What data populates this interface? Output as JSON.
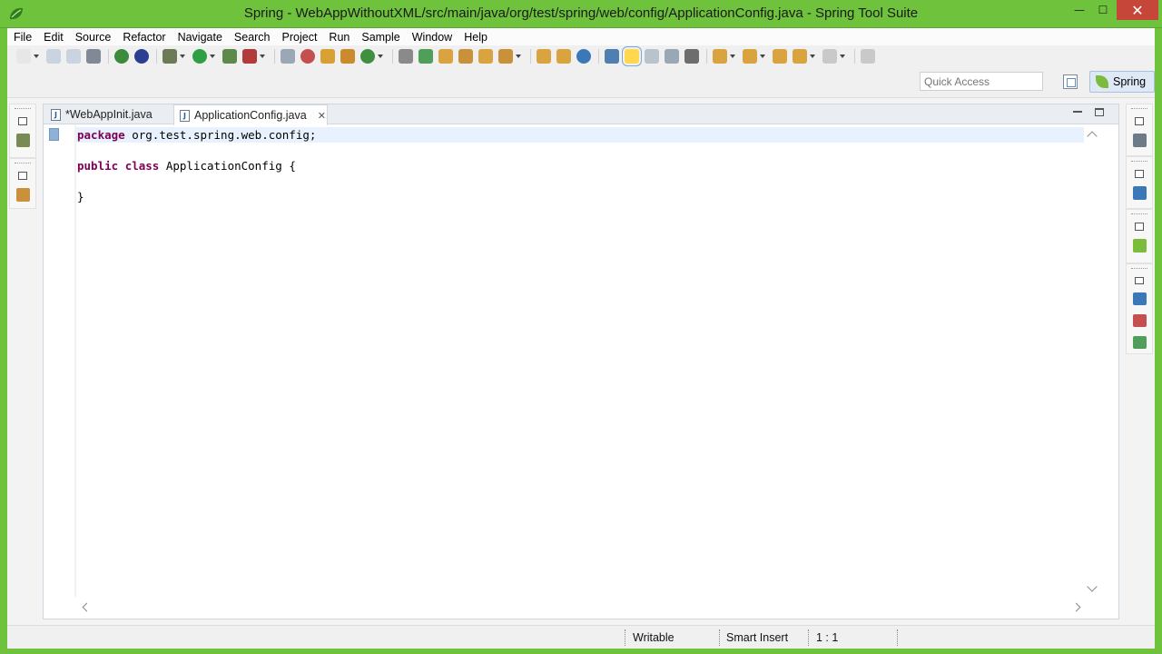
{
  "window": {
    "title": "Spring - WebAppWithoutXML/src/main/java/org/test/spring/web/config/ApplicationConfig.java - Spring Tool Suite",
    "minimize_glyph": "—",
    "maximize_glyph": "☐",
    "close_glyph": "✕",
    "frame_color": "#6fc23c"
  },
  "menu": [
    {
      "label": "File"
    },
    {
      "label": "Edit"
    },
    {
      "label": "Source"
    },
    {
      "label": "Refactor"
    },
    {
      "label": "Navigate"
    },
    {
      "label": "Search"
    },
    {
      "label": "Project"
    },
    {
      "label": "Run"
    },
    {
      "label": "Sample"
    },
    {
      "label": "Window"
    },
    {
      "label": "Help"
    }
  ],
  "toolbar_icons": [
    {
      "name": "new-icon",
      "color": "#e7e7e7",
      "caret": true
    },
    {
      "name": "save-icon",
      "color": "#c9d4e0"
    },
    {
      "name": "save-all-icon",
      "color": "#c9d4e0"
    },
    {
      "name": "print-icon",
      "color": "#7f8a96"
    },
    {
      "name": "sep"
    },
    {
      "name": "spring-globe-icon",
      "color": "#3c8b3c",
      "round": true
    },
    {
      "name": "spring-server-icon",
      "color": "#2a3f8f",
      "round": true
    },
    {
      "name": "sep"
    },
    {
      "name": "debug-icon",
      "color": "#6b7b55",
      "caret": true
    },
    {
      "name": "run-icon",
      "color": "#2f9e44",
      "round": true,
      "caret": true
    },
    {
      "name": "coverage-icon",
      "color": "#5d8a4a"
    },
    {
      "name": "external-tools-icon",
      "color": "#b23a3a",
      "caret": true
    },
    {
      "name": "sep"
    },
    {
      "name": "toggle-breakpoint-icon",
      "color": "#9aa7b5"
    },
    {
      "name": "skip-breakpoints-icon",
      "color": "#c44f4f",
      "round": true
    },
    {
      "name": "new-java-project-icon",
      "color": "#d9a033"
    },
    {
      "name": "new-package-icon",
      "color": "#c98b2c"
    },
    {
      "name": "new-class-icon",
      "color": "#3f8f3f",
      "round": true,
      "caret": true
    },
    {
      "name": "sep"
    },
    {
      "name": "search-refs-icon",
      "color": "#8a8a8a"
    },
    {
      "name": "open-resource-icon",
      "color": "#4f9e5a"
    },
    {
      "name": "open-type-icon",
      "color": "#d9a440"
    },
    {
      "name": "hierarchy-icon",
      "color": "#c9923a"
    },
    {
      "name": "folder-open-icon",
      "color": "#d9a440"
    },
    {
      "name": "magic-wand-icon",
      "color": "#c9923a",
      "caret": true
    },
    {
      "name": "sep"
    },
    {
      "name": "open-task-icon",
      "color": "#d9a440"
    },
    {
      "name": "open-folder-icon",
      "color": "#d9a440"
    },
    {
      "name": "web-browser-icon",
      "color": "#3a78b8",
      "round": true
    },
    {
      "name": "sep"
    },
    {
      "name": "search-icon",
      "color": "#4f7fb0"
    },
    {
      "name": "highlight-icon",
      "color": "#ffd84d",
      "active": true
    },
    {
      "name": "mark-occurrences-icon",
      "color": "#b9c3cc"
    },
    {
      "name": "block-selection-icon",
      "color": "#9aa7b5"
    },
    {
      "name": "show-whitespace-icon",
      "color": "#6d6d6d"
    },
    {
      "name": "sep"
    },
    {
      "name": "next-annotation-icon",
      "color": "#d9a440",
      "caret": true
    },
    {
      "name": "prev-annotation-icon",
      "color": "#d9a440",
      "caret": true
    },
    {
      "name": "last-edit-icon",
      "color": "#d9a440"
    },
    {
      "name": "back-icon",
      "color": "#d9a440",
      "caret": true
    },
    {
      "name": "forward-icon",
      "color": "#c9c9c9",
      "caret": true
    },
    {
      "name": "sep"
    },
    {
      "name": "pin-editor-icon",
      "color": "#c9c9c9"
    }
  ],
  "quick_access": {
    "placeholder": "Quick Access"
  },
  "perspective": {
    "label": "Spring"
  },
  "tabs": [
    {
      "label": "*WebAppInit.java",
      "active": false
    },
    {
      "label": "ApplicationConfig.java",
      "active": true
    }
  ],
  "editor": {
    "lines": [
      {
        "parts": [
          {
            "t": "package",
            "kw": true
          },
          {
            "t": " org.test.spring.web.config;",
            "kw": false
          }
        ],
        "current": true
      },
      {
        "parts": [],
        "current": false
      },
      {
        "parts": [
          {
            "t": "public",
            "kw": true
          },
          {
            "t": " ",
            "kw": false
          },
          {
            "t": "class",
            "kw": true
          },
          {
            "t": " ApplicationConfig {",
            "kw": false
          }
        ],
        "current": false
      },
      {
        "parts": [],
        "current": false
      },
      {
        "parts": [
          {
            "t": "}",
            "kw": false
          }
        ],
        "current": false
      }
    ]
  },
  "status": {
    "writable": "Writable",
    "insert_mode": "Smart Insert",
    "position": "1 : 1"
  },
  "left_trim_icons": [
    {
      "name": "package-explorer-icon",
      "color": "#7a8a55"
    },
    {
      "name": "hierarchy-view-icon",
      "color": "#c9923a"
    }
  ],
  "right_trim_icons": [
    {
      "name": "task-list-icon",
      "color": "#6d7a88"
    },
    {
      "name": "outline-icon",
      "color": "#3a78b8"
    },
    {
      "name": "spring-explorer-icon",
      "color": "#7cbc3c"
    },
    {
      "name": "console-icon",
      "color": "#3a78b8"
    },
    {
      "name": "problems-icon",
      "color": "#c44f4f"
    },
    {
      "name": "servers-icon",
      "color": "#4f9e5a"
    }
  ]
}
